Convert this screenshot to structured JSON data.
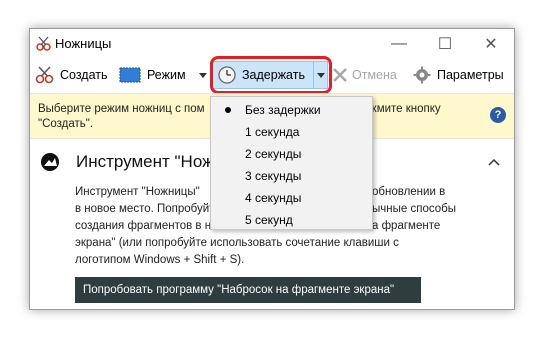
{
  "window": {
    "title": "Ножницы",
    "controls": {
      "minimize": "—",
      "maximize": "☐",
      "close": "✕"
    }
  },
  "toolbar": {
    "create_label": "Создать",
    "mode_label": "Режим",
    "delay_label": "Задержать",
    "cancel_label": "Отмена",
    "options_label": "Параметры"
  },
  "infobar": {
    "line1_left": "Выберите режим ножниц с пом",
    "line1_right": "жмите кнопку",
    "line2": "\"Создать\"."
  },
  "tool_section": {
    "title": "Инструмент \"Нож",
    "body_left": [
      "Инструмент \"Ножницы\"",
      "в новое место. Попробуйт",
      "создания фрагментов в н",
      "экрана\" (или попробуйте использовать сочетание клавиши с",
      "логотипом Windows + Shift + S)."
    ],
    "body_right": [
      "обновлении в",
      "ычные способы",
      "а фрагменте"
    ],
    "try_button_label": "Попробовать программу \"Набросок на фрагменте экрана\""
  },
  "delay_menu": {
    "selected_index": 0,
    "items": [
      "Без задержки",
      "1 секунда",
      "2 секунды",
      "3 секунды",
      "4 секунды",
      "5 секунд"
    ]
  },
  "colors": {
    "highlight": "#e21f26",
    "infobar_bg": "#fff8cc",
    "button_dark": "#2e3d40",
    "delay_pressed": "#cce4f7"
  }
}
